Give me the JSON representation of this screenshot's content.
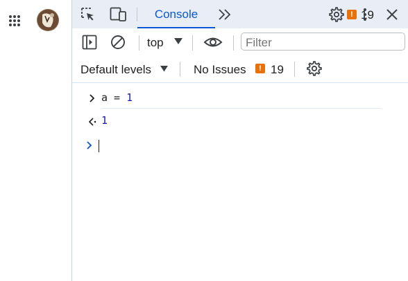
{
  "left_strip": {
    "apps_icon": "grid-apps-icon",
    "avatar_icon": "avatar"
  },
  "tabbar": {
    "inspect_icon": "inspect-element-icon",
    "device_icon": "device-toolbar-icon",
    "active_tab": "Console",
    "more_tabs_icon": "chevron-double-right-icon",
    "issues_badge_glyph": "!",
    "issues_count": "19",
    "settings_icon": "gear-icon",
    "menu_icon": "kebab-menu-icon",
    "close_icon": "close-icon"
  },
  "toolbar": {
    "sidebar_icon": "show-sidebar-icon",
    "clear_icon": "clear-console-icon",
    "context": "top",
    "eye_icon": "eye-icon",
    "filter_placeholder": "Filter",
    "levels": "Default levels",
    "no_issues": "No Issues",
    "no_issues_badge_glyph": "!",
    "no_issues_count": "19",
    "console_settings_icon": "gear-icon"
  },
  "console": {
    "entries": [
      {
        "type": "input",
        "text_var": "a",
        "text_op": " = ",
        "text_num": "1"
      },
      {
        "type": "result",
        "text_num": "1"
      }
    ],
    "prompt_icon": "prompt-chevron-icon"
  },
  "colors": {
    "accent": "#0b57d0",
    "tabbar_bg": "#e9eef6",
    "issue_orange": "#e8710a",
    "number_blue": "#1a1aa6"
  }
}
